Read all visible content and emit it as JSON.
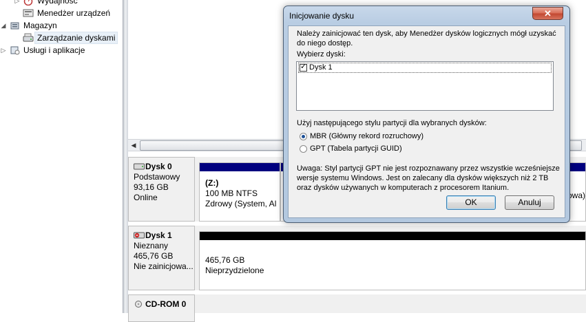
{
  "tree": {
    "items": [
      {
        "label": "Wydajność",
        "level": 2
      },
      {
        "label": "Menedżer urządzeń",
        "level": 2
      },
      {
        "label": "Magazyn",
        "level": 1,
        "expanded": true
      },
      {
        "label": "Zarządzanie dyskami",
        "level": 2,
        "selected": true
      },
      {
        "label": "Usługi i aplikacje",
        "level": 1,
        "expanded": false
      }
    ]
  },
  "disks": [
    {
      "title": "Dysk 0",
      "type": "Podstawowy",
      "size": "93,16 GB",
      "status": "Online",
      "volume": {
        "name": "(Z:)",
        "detail": "100 MB NTFS",
        "health": "Zdrowy (System, Al"
      },
      "overflow_text": "owa)"
    },
    {
      "title": "Dysk 1",
      "type": "Nieznany",
      "size": "465,76 GB",
      "status": "Nie zainicjowa...",
      "volume": {
        "size": "465,76 GB",
        "state": "Nieprzydzielone"
      }
    },
    {
      "title": "CD-ROM 0"
    }
  ],
  "dialog": {
    "title": "Inicjowanie dysku",
    "close_label": "✕",
    "intro_line1": "Należy zainicjować ten dysk, aby Menedżer dysków logicznych mógł uzyskać",
    "intro_line2": "do niego dostęp.",
    "select_label": "Wybierz dyski:",
    "disk_item": "Dysk 1",
    "style_label": "Użyj następującego stylu partycji dla wybranych dysków:",
    "mbr_label": "MBR (Główny rekord rozruchowy)",
    "gpt_label": "GPT (Tabela partycji GUID)",
    "note_line1": "Uwaga: Styl partycji GPT nie jest rozpoznawany przez wszystkie wcześniejsze",
    "note_line2": "wersje systemu Windows. Jest on zalecany dla dysków większych niż 2 TB",
    "note_line3": "oraz dysków używanych w komputerach z procesorem Itanium.",
    "ok_label": "OK",
    "cancel_label": "Anuluj",
    "selected_style": "MBR"
  },
  "colors": {
    "primary_partition": "#00007f",
    "unallocated": "#000000",
    "dialog_frame": "#b9cde3"
  }
}
